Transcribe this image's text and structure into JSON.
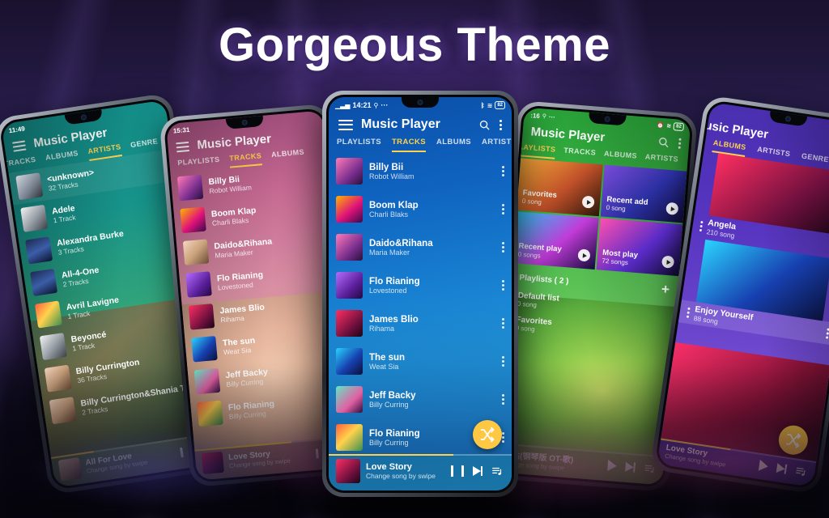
{
  "headline": "Gorgeous Theme",
  "colors": {
    "accent_yellow": "#ffd24d",
    "fab_yellow": "#ffc844",
    "phone1_theme": "#17938a",
    "phone2_theme": "#c76a93",
    "phone3_theme": "#0f63bf",
    "phone4_theme": "#3bb343",
    "phone5_theme": "#5634c0",
    "background_purple": "#2a1f4f"
  },
  "common": {
    "app_title": "Music Player",
    "player_hint": "Change song by swipe",
    "icons": {
      "menu": "hamburger-menu-icon",
      "search": "search-icon",
      "overflow": "overflow-menu-icon",
      "shuffle": "shuffle-icon",
      "play": "play-icon",
      "pause": "pause-icon",
      "next": "next-track-icon",
      "queue": "playlist-queue-icon"
    }
  },
  "phone1": {
    "status": {
      "time": "11:49"
    },
    "title": "Music Player",
    "tabs": [
      {
        "label": "TRACKS",
        "active": false
      },
      {
        "label": "ALBUMS",
        "active": false
      },
      {
        "label": "ARTISTS",
        "active": true
      },
      {
        "label": "GENRE",
        "active": false
      }
    ],
    "artists": [
      {
        "name": "<unknown>",
        "tracks": "32 Tracks"
      },
      {
        "name": "Adele",
        "tracks": "1 Track"
      },
      {
        "name": "Alexandra Burke",
        "tracks": "3 Tracks"
      },
      {
        "name": "All-4-One",
        "tracks": "2 Tracks"
      },
      {
        "name": "Avril Lavigne",
        "tracks": "1 Track"
      },
      {
        "name": "Beyoncé",
        "tracks": "1 Track"
      },
      {
        "name": "Billy Currington",
        "tracks": "36 Tracks"
      },
      {
        "name": "Billy Currington&Shania Twain",
        "tracks": "2 Tracks"
      }
    ],
    "player": {
      "track": "All For Love",
      "hint": "Change song by swipe"
    }
  },
  "phone2": {
    "status": {
      "time": "15:31"
    },
    "title": "Music Player",
    "tabs": [
      {
        "label": "PLAYLISTS",
        "active": false
      },
      {
        "label": "TRACKS",
        "active": true
      },
      {
        "label": "ALBUMS",
        "active": false
      }
    ],
    "tracks": [
      {
        "title": "Billy Bii",
        "artist": "Robot William"
      },
      {
        "title": "Boom Klap",
        "artist": "Charli Blaks"
      },
      {
        "title": "Daido&Rihana",
        "artist": "Maria Maker"
      },
      {
        "title": "Flo Rianing",
        "artist": "Lovestoned"
      },
      {
        "title": "James Blio",
        "artist": "Rihama"
      },
      {
        "title": "The sun",
        "artist": "Weat Sia"
      },
      {
        "title": "Jeff Backy",
        "artist": "Billy Curring"
      },
      {
        "title": "Flo Rianing",
        "artist": "Billy Curring"
      }
    ],
    "player": {
      "track": "Love Story",
      "hint": "Change song by swipe"
    }
  },
  "phone3": {
    "status": {
      "time": "14:21",
      "battery": "82"
    },
    "title": "Music Player",
    "tabs": [
      {
        "label": "PLAYLISTS",
        "active": false
      },
      {
        "label": "TRACKS",
        "active": true
      },
      {
        "label": "ALBUMS",
        "active": false
      },
      {
        "label": "ARTISTS",
        "active": false
      }
    ],
    "tracks": [
      {
        "title": "Billy Bii",
        "artist": "Robot William"
      },
      {
        "title": "Boom Klap",
        "artist": "Charli Blaks"
      },
      {
        "title": "Daido&Rihana",
        "artist": "Maria Maker"
      },
      {
        "title": "Flo Rianing",
        "artist": "Lovestoned"
      },
      {
        "title": "James Blio",
        "artist": "Rihama"
      },
      {
        "title": "The sun",
        "artist": "Weat Sia"
      },
      {
        "title": "Jeff Backy",
        "artist": "Billy Curring"
      },
      {
        "title": "Flo Rianing",
        "artist": "Billy Curring"
      }
    ],
    "player": {
      "track": "Love Story",
      "hint": "Change song by swipe"
    }
  },
  "phone4": {
    "status": {
      "time": ":16"
    },
    "title": "Music Player",
    "tabs": [
      {
        "label": "PLAYLISTS",
        "active": true
      },
      {
        "label": "TRACKS",
        "active": false
      },
      {
        "label": "ALBUMS",
        "active": false
      },
      {
        "label": "ARTISTS",
        "active": false
      }
    ],
    "tiles": [
      {
        "name": "Favorites",
        "count": "0 song"
      },
      {
        "name": "Recent add",
        "count": "0 song"
      },
      {
        "name": "Recent play",
        "count": "0 songs"
      },
      {
        "name": "Most play",
        "count": "72 songs"
      }
    ],
    "playlists_header": "Playlists ( 2 )",
    "add_label": "+",
    "playlists": [
      {
        "name": "Default list",
        "count": "0 song"
      },
      {
        "name": "Favorites",
        "count": "0 song"
      }
    ],
    "player": {
      "track": "车站(钢琴版 OT-歌)",
      "hint": "Change song by swipe"
    }
  },
  "phone5": {
    "title": "Music Player",
    "tabs": [
      {
        "label": "ALBUMS",
        "active": true
      },
      {
        "label": "ARTISTS",
        "active": false
      },
      {
        "label": "GENRE",
        "active": false
      }
    ],
    "albums": [
      {
        "name": "Angela",
        "count": "210 song"
      },
      {
        "name": "Enjoy Yourself",
        "count": "88 song"
      }
    ],
    "player": {
      "track": "Love Story",
      "hint": "Change song by swipe"
    }
  }
}
